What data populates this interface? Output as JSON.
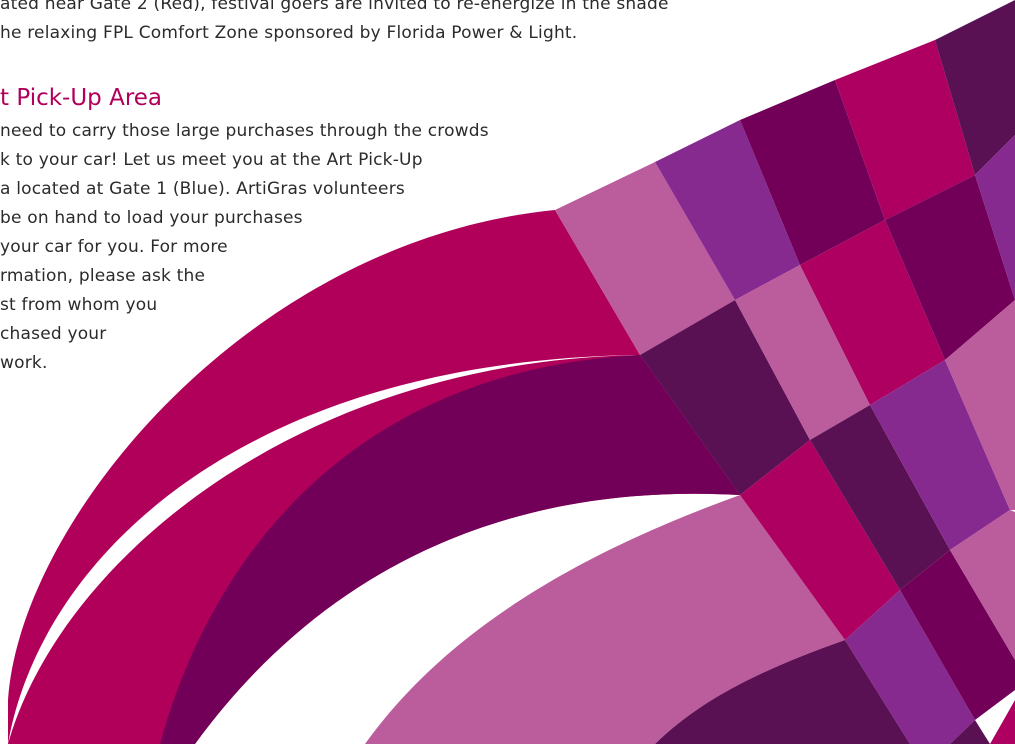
{
  "intro": {
    "line1": "ated near Gate 2 (Red), festival goers are invited to re-energize in the shade",
    "line2": "he relaxing FPL Comfort Zone sponsored by Florida Power & Light."
  },
  "pickup": {
    "heading": "t Pick-Up Area",
    "lines": [
      "need to carry those large purchases through the crowds",
      "k to your car! Let us meet you at the Art Pick-Up",
      "a located at Gate 1 (Blue). ArtiGras volunteers",
      "be on hand to load your purchases",
      "your car for you. For more",
      "rmation, please ask the",
      "st from whom you",
      "chased your",
      "work."
    ]
  },
  "colors": {
    "heading": "#b0005a",
    "body_text": "#2b2b2b",
    "magenta": "#b0005a",
    "plum": "#730058",
    "dark_plum": "#5a1154",
    "orchid": "#bb5c9d",
    "violet": "#872a8f",
    "berry": "#ad0060"
  }
}
